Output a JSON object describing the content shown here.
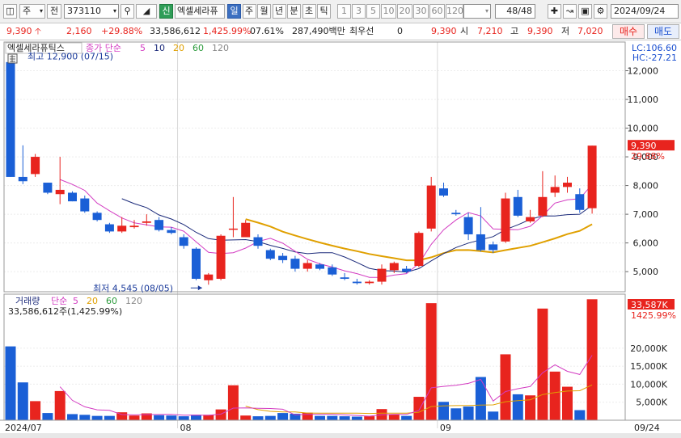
{
  "toolbar": {
    "market_label": "주",
    "prev_label": "전",
    "code": "373110",
    "new_badge": "신",
    "stock_name": "엑셀세라퓨",
    "periods": [
      {
        "label": "일",
        "selected": true
      },
      {
        "label": "주",
        "selected": false
      },
      {
        "label": "월",
        "selected": false
      },
      {
        "label": "년",
        "selected": false
      },
      {
        "label": "분",
        "selected": false
      },
      {
        "label": "초",
        "selected": false
      },
      {
        "label": "틱",
        "selected": false
      }
    ],
    "intervals": [
      "1",
      "3",
      "5",
      "10",
      "20",
      "30",
      "60",
      "120"
    ],
    "count": "48/48",
    "date": "2024/09/24"
  },
  "quote": {
    "price": "9,390",
    "change": "2,160",
    "change_pct": "+29.88%",
    "volume": "33,586,612",
    "volume_pct": "1,425.99%",
    "turnover_pct": "07.61%",
    "amount": "287,490백만",
    "best_label": "최우선",
    "best_value": "0",
    "ask": "9,390",
    "open_label": "시",
    "open": "7,210",
    "high_label": "고",
    "high": "9,390",
    "low_label": "저",
    "low": "7,020",
    "buy_label": "매수",
    "sell_label": "매도"
  },
  "price_panel": {
    "stock_title": "엑셀세라퓨틱스",
    "ma_label": "종가 단순",
    "ma_periods": [
      "5",
      "10",
      "20",
      "60",
      "120"
    ],
    "lc": "LC:106.60",
    "hc": "HC:-27.21",
    "high_note": "최고 12,900 (07/15)",
    "low_note": "최저 4,545 (08/05)",
    "current_tag": "9,390",
    "current_pct": "29.88%"
  },
  "volume_panel": {
    "label": "거래량",
    "ma_label": "단순",
    "ma_periods": [
      "5",
      "20",
      "60",
      "120"
    ],
    "summary": "33,586,612주(1,425.99%)",
    "current_tag": "33,587K",
    "current_pct": "1425.99%"
  },
  "axis": {
    "x_labels": [
      "2024/07",
      "08",
      "09",
      "09/24"
    ],
    "price_ticks": [
      "12,000",
      "11,000",
      "10,000",
      "9,000",
      "8,000",
      "7,000",
      "6,000",
      "5,000"
    ],
    "volume_ticks": [
      "20,000K",
      "15,000K",
      "10,000K",
      "5,000K"
    ]
  },
  "colors": {
    "up": "#e8241e",
    "down": "#1a5fd6",
    "ma5": "#d33cc2",
    "ma10": "#1b2a7a",
    "ma20": "#e0a000",
    "ma60": "#2a9a3a",
    "ma120": "#888888"
  },
  "chart_data": {
    "type": "candlestick",
    "ylim": [
      4300,
      13000
    ],
    "volume_ylim": [
      0,
      35000
    ],
    "candles": [
      {
        "date": "07/12",
        "o": 12300,
        "h": 12900,
        "l": 8300,
        "c": 8300,
        "v": 20500
      },
      {
        "date": "07/15",
        "o": 8300,
        "h": 9400,
        "l": 8050,
        "c": 8150,
        "v": 10500
      },
      {
        "date": "07/16",
        "o": 8400,
        "h": 9100,
        "l": 8300,
        "c": 9000,
        "v": 5300
      },
      {
        "date": "07/17",
        "o": 8100,
        "h": 8100,
        "l": 7700,
        "c": 7750,
        "v": 2000
      },
      {
        "date": "07/18",
        "o": 7700,
        "h": 9000,
        "l": 7350,
        "c": 7850,
        "v": 8100
      },
      {
        "date": "07/19",
        "o": 7750,
        "h": 7800,
        "l": 7450,
        "c": 7450,
        "v": 1700
      },
      {
        "date": "07/22",
        "o": 7550,
        "h": 7650,
        "l": 7050,
        "c": 7100,
        "v": 1500
      },
      {
        "date": "07/23",
        "o": 7050,
        "h": 7100,
        "l": 6750,
        "c": 6800,
        "v": 1200
      },
      {
        "date": "07/24",
        "o": 6650,
        "h": 6700,
        "l": 6350,
        "c": 6400,
        "v": 1200
      },
      {
        "date": "07/25",
        "o": 6400,
        "h": 6900,
        "l": 6350,
        "c": 6600,
        "v": 2200
      },
      {
        "date": "07/26",
        "o": 6550,
        "h": 6800,
        "l": 6500,
        "c": 6600,
        "v": 1300
      },
      {
        "date": "07/29",
        "o": 6700,
        "h": 7000,
        "l": 6600,
        "c": 6750,
        "v": 1900
      },
      {
        "date": "07/30",
        "o": 6800,
        "h": 6900,
        "l": 6400,
        "c": 6450,
        "v": 1400
      },
      {
        "date": "07/31",
        "o": 6450,
        "h": 6550,
        "l": 6300,
        "c": 6350,
        "v": 1300
      },
      {
        "date": "08/01",
        "o": 6200,
        "h": 6300,
        "l": 5800,
        "c": 5900,
        "v": 1100
      },
      {
        "date": "08/02",
        "o": 5800,
        "h": 5850,
        "l": 4700,
        "c": 4750,
        "v": 1500
      },
      {
        "date": "08/05",
        "o": 4700,
        "h": 4950,
        "l": 4545,
        "c": 4900,
        "v": 1500
      },
      {
        "date": "08/06",
        "o": 4750,
        "h": 6300,
        "l": 4700,
        "c": 6250,
        "v": 3000
      },
      {
        "date": "08/07",
        "o": 6500,
        "h": 7600,
        "l": 6200,
        "c": 6500,
        "v": 9700
      },
      {
        "date": "08/08",
        "o": 6200,
        "h": 6800,
        "l": 6200,
        "c": 6700,
        "v": 1300
      },
      {
        "date": "08/09",
        "o": 6200,
        "h": 6300,
        "l": 5800,
        "c": 5900,
        "v": 1100
      },
      {
        "date": "08/12",
        "o": 5750,
        "h": 5800,
        "l": 5400,
        "c": 5450,
        "v": 1200
      },
      {
        "date": "08/13",
        "o": 5550,
        "h": 5650,
        "l": 5300,
        "c": 5400,
        "v": 2000
      },
      {
        "date": "08/14",
        "o": 5450,
        "h": 5550,
        "l": 5000,
        "c": 5100,
        "v": 1800
      },
      {
        "date": "08/16",
        "o": 5100,
        "h": 5400,
        "l": 5000,
        "c": 5300,
        "v": 2100
      },
      {
        "date": "08/19",
        "o": 5250,
        "h": 5300,
        "l": 5050,
        "c": 5100,
        "v": 1200
      },
      {
        "date": "08/20",
        "o": 5150,
        "h": 5250,
        "l": 4850,
        "c": 4900,
        "v": 1200
      },
      {
        "date": "08/21",
        "o": 4800,
        "h": 4950,
        "l": 4700,
        "c": 4750,
        "v": 1100
      },
      {
        "date": "08/22",
        "o": 4650,
        "h": 4750,
        "l": 4550,
        "c": 4600,
        "v": 1000
      },
      {
        "date": "08/23",
        "o": 4600,
        "h": 4700,
        "l": 4550,
        "c": 4650,
        "v": 1100
      },
      {
        "date": "08/26",
        "o": 4650,
        "h": 5250,
        "l": 4550,
        "c": 5100,
        "v": 3100
      },
      {
        "date": "08/27",
        "o": 5050,
        "h": 5350,
        "l": 4950,
        "c": 5300,
        "v": 1700
      },
      {
        "date": "08/28",
        "o": 5100,
        "h": 5200,
        "l": 4950,
        "c": 5000,
        "v": 1200
      },
      {
        "date": "08/29",
        "o": 5200,
        "h": 6400,
        "l": 5150,
        "c": 6350,
        "v": 6500
      },
      {
        "date": "08/30",
        "o": 6500,
        "h": 8300,
        "l": 6400,
        "c": 8000,
        "v": 32500
      },
      {
        "date": "09/02",
        "o": 7900,
        "h": 8100,
        "l": 7600,
        "c": 7650,
        "v": 5100
      },
      {
        "date": "09/03",
        "o": 7050,
        "h": 7150,
        "l": 6950,
        "c": 7000,
        "v": 3300
      },
      {
        "date": "09/04",
        "o": 6900,
        "h": 7050,
        "l": 6100,
        "c": 6300,
        "v": 3800
      },
      {
        "date": "09/05",
        "o": 6300,
        "h": 7250,
        "l": 5700,
        "c": 5750,
        "v": 12000
      },
      {
        "date": "09/06",
        "o": 5950,
        "h": 6050,
        "l": 5650,
        "c": 5750,
        "v": 2400
      },
      {
        "date": "09/09",
        "o": 6050,
        "h": 7750,
        "l": 6000,
        "c": 7550,
        "v": 18300
      },
      {
        "date": "09/10",
        "o": 7600,
        "h": 7850,
        "l": 6900,
        "c": 6950,
        "v": 7200
      },
      {
        "date": "09/11",
        "o": 6750,
        "h": 7150,
        "l": 6700,
        "c": 6900,
        "v": 6900
      },
      {
        "date": "09/12",
        "o": 6950,
        "h": 8500,
        "l": 6900,
        "c": 7600,
        "v": 31000
      },
      {
        "date": "09/13",
        "o": 7750,
        "h": 8350,
        "l": 7600,
        "c": 7950,
        "v": 13500
      },
      {
        "date": "09/19",
        "o": 7950,
        "h": 8300,
        "l": 7750,
        "c": 8100,
        "v": 9300
      },
      {
        "date": "09/20",
        "o": 7700,
        "h": 7900,
        "l": 7050,
        "c": 7150,
        "v": 2800
      },
      {
        "date": "09/23",
        "o": 7210,
        "h": 9390,
        "l": 7020,
        "c": 9390,
        "v": 33587
      }
    ]
  }
}
